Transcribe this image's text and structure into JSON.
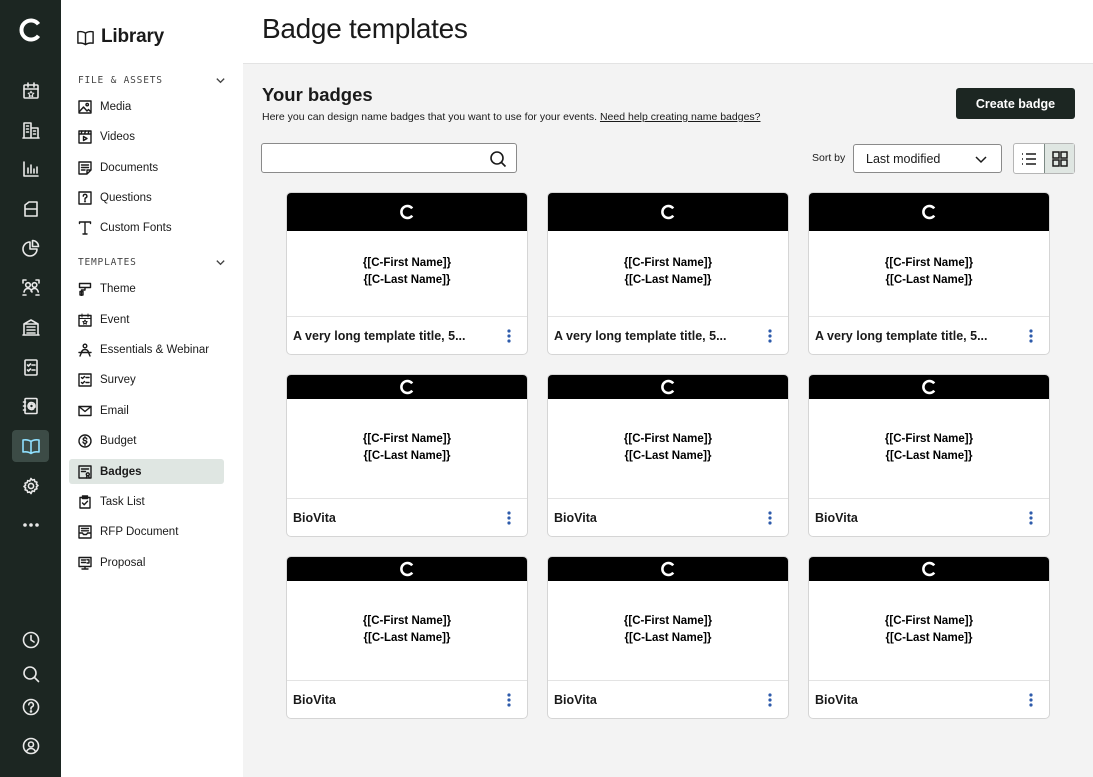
{
  "rail": {
    "items": [
      {
        "name": "rail-calendar-star",
        "icon": "calendar-star-icon"
      },
      {
        "name": "rail-buildings",
        "icon": "buildings-icon"
      },
      {
        "name": "rail-analytics",
        "icon": "bar-chart-icon"
      },
      {
        "name": "rail-files",
        "icon": "folder-icon"
      },
      {
        "name": "rail-reports",
        "icon": "pie-chart-icon"
      },
      {
        "name": "rail-people",
        "icon": "people-icon"
      },
      {
        "name": "rail-venues",
        "icon": "venue-icon"
      },
      {
        "name": "rail-checklist",
        "icon": "checklist-icon"
      },
      {
        "name": "rail-address-book",
        "icon": "address-book-icon"
      },
      {
        "name": "rail-library",
        "icon": "open-book-icon",
        "active": true
      },
      {
        "name": "rail-settings",
        "icon": "gear-icon"
      },
      {
        "name": "rail-more",
        "icon": "more-horizontal-icon"
      },
      {
        "name": "rail-recent",
        "icon": "clock-icon"
      },
      {
        "name": "rail-search",
        "icon": "search-icon"
      },
      {
        "name": "rail-help",
        "icon": "help-icon"
      },
      {
        "name": "rail-profile",
        "icon": "user-circle-icon"
      }
    ]
  },
  "library": {
    "title": "Library",
    "sections": [
      {
        "label": "FILE & ASSETS",
        "items": [
          {
            "label": "Media",
            "icon": "image-icon"
          },
          {
            "label": "Videos",
            "icon": "video-icon"
          },
          {
            "label": "Documents",
            "icon": "document-icon"
          },
          {
            "label": "Questions",
            "icon": "question-box-icon"
          },
          {
            "label": "Custom Fonts",
            "icon": "font-icon"
          }
        ]
      },
      {
        "label": "TEMPLATES",
        "items": [
          {
            "label": "Theme",
            "icon": "paint-roller-icon"
          },
          {
            "label": "Event",
            "icon": "calendar-star-icon"
          },
          {
            "label": "Essentials & Webinar",
            "icon": "presenter-icon"
          },
          {
            "label": "Survey",
            "icon": "survey-icon"
          },
          {
            "label": "Email",
            "icon": "envelope-icon"
          },
          {
            "label": "Budget",
            "icon": "dollar-circle-icon"
          },
          {
            "label": "Badges",
            "icon": "badge-icon",
            "active": true
          },
          {
            "label": "Task List",
            "icon": "clipboard-check-icon"
          },
          {
            "label": "RFP Document",
            "icon": "inbox-icon"
          },
          {
            "label": "Proposal",
            "icon": "proposal-icon"
          }
        ]
      }
    ]
  },
  "header": {
    "title": "Badge templates"
  },
  "main": {
    "section_title": "Your badges",
    "description": "Here you can design name badges that you want to use for your events.",
    "help_link": "Need help creating name badges?",
    "create_label": "Create badge",
    "search": {
      "value": "",
      "placeholder": ""
    },
    "sort_label": "Sort by",
    "sort_value": "Last modified",
    "view_mode": "grid"
  },
  "badges": [
    {
      "title": "A very long template title, 5...",
      "first": "{[C-First Name]}",
      "last": "{[C-Last Name]}"
    },
    {
      "title": "A very long template title, 5...",
      "first": "{[C-First Name]}",
      "last": "{[C-Last Name]}"
    },
    {
      "title": "A very long template title, 5...",
      "first": "{[C-First Name]}",
      "last": "{[C-Last Name]}"
    },
    {
      "title": "BioVita",
      "first": "{[C-First Name]}",
      "last": "{[C-Last Name]}"
    },
    {
      "title": "BioVita",
      "first": "{[C-First Name]}",
      "last": "{[C-Last Name]}"
    },
    {
      "title": "BioVita",
      "first": "{[C-First Name]}",
      "last": "{[C-Last Name]}"
    },
    {
      "title": "BioVita",
      "first": "{[C-First Name]}",
      "last": "{[C-Last Name]}"
    },
    {
      "title": "BioVita",
      "first": "{[C-First Name]}",
      "last": "{[C-Last Name]}"
    },
    {
      "title": "BioVita",
      "first": "{[C-First Name]}",
      "last": "{[C-Last Name]}"
    }
  ],
  "colors": {
    "rail_bg": "#1c2622",
    "rail_active": "#3c4b46",
    "accent_blue": "#2e5bab",
    "active_item_bg": "#dfe6e2",
    "primary_button": "#1c2622"
  }
}
